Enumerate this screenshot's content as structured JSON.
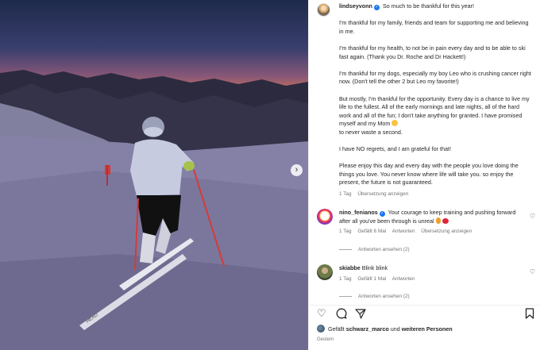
{
  "photo": {
    "alt_icon": "next-arrow",
    "next_label": "›"
  },
  "post": {
    "username": "lindseyvonn",
    "first_line": "So much to be thankful for this year!",
    "paragraphs": [
      "I'm thankful for my family, friends and team for supporting me and believing in me.",
      "I'm thankful for my health, to not be in pain every day and to be able to ski fast again. (Thank you Dr. Roche and Dr Hackett!)",
      "I'm thankful for my dogs, especially my boy Leo who is crushing cancer right now. (Don't tell the other 2 but Leo my favorite!)",
      "But mostly, I'm thankful for the opportunity. Every day is a chance to live my life to the fullest. All of the early mornings and late nights, all of the hard work and all of the fun; I don't take anything for granted. I have promised myself and my Mom",
      "to never waste a second.",
      "I have NO regrets, and I am grateful for that!",
      "Please enjoy this day and every day with the people you love doing the things you love. You never know where life will take you. so enjoy the present, the future is not guaranteed."
    ],
    "time": "1 Tag",
    "translate": "Übersetzung anzeigen"
  },
  "comments": [
    {
      "username": "nino_fenianos",
      "text": "Your courage to keep training and pushing forward after all you've been through is unreal",
      "time": "1 Tag",
      "likes": "Gefällt 6 Mal",
      "reply": "Antworten",
      "translate": "Übersetzung anzeigen",
      "replies": "Antworten ansehen (2)"
    },
    {
      "username": "skiabbe",
      "text": "Blink blink",
      "time": "1 Tag",
      "likes": "Gefällt 1 Mal",
      "reply": "Antworten",
      "replies": "Antworten ansehen (2)"
    }
  ],
  "footer": {
    "liked_prefix": "Gefällt",
    "liked_user": "schwarz_marco",
    "liked_and": "und",
    "liked_others": "weiteren Personen",
    "date": "Gestern"
  },
  "colors": {
    "verified": "#1877f2",
    "muted": "#737373",
    "text": "#262626"
  },
  "icons": [
    "heart-icon",
    "comment-icon",
    "share-icon",
    "bookmark-icon",
    "verified-icon",
    "chevron-right-icon"
  ]
}
